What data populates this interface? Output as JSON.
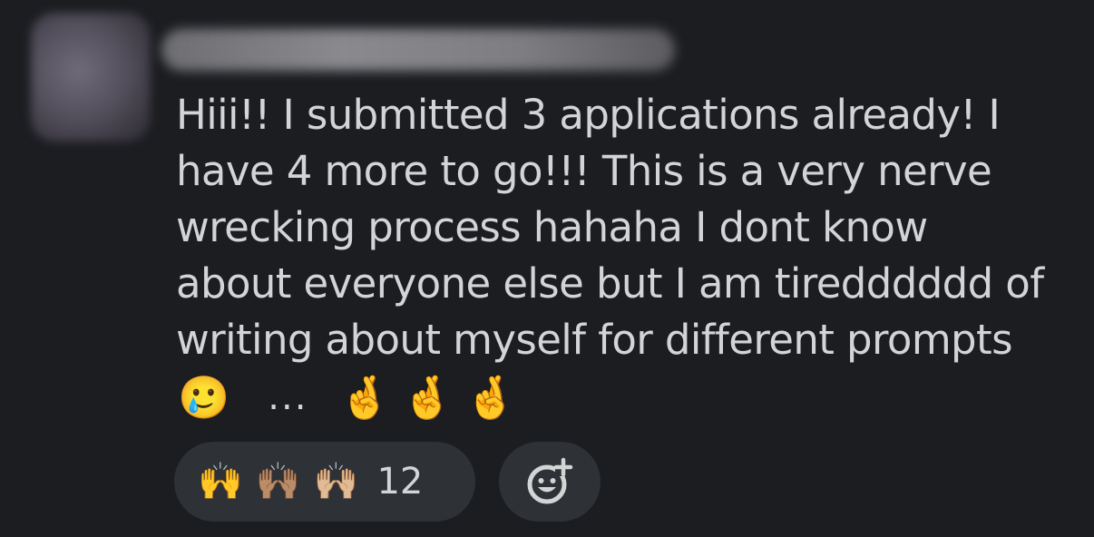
{
  "message": {
    "text": "Hiii!! I submitted 3 applications already! I\nhave 4 more to go!!! This is a very nerve\nwrecking process hahaha I dont know\nabout everyone else but I am tiredddddd of\nwriting about myself for different prompts",
    "emojis": {
      "smile_tear": "🥲",
      "ellipsis": "...",
      "crossed_fingers": [
        "🤞",
        "🤞",
        "🤞"
      ]
    }
  },
  "reactions": {
    "emojis": [
      "🙌",
      "🙌🏽",
      "🙌🏼"
    ],
    "count": "12",
    "add_reaction_icon": "add-reaction-icon"
  }
}
